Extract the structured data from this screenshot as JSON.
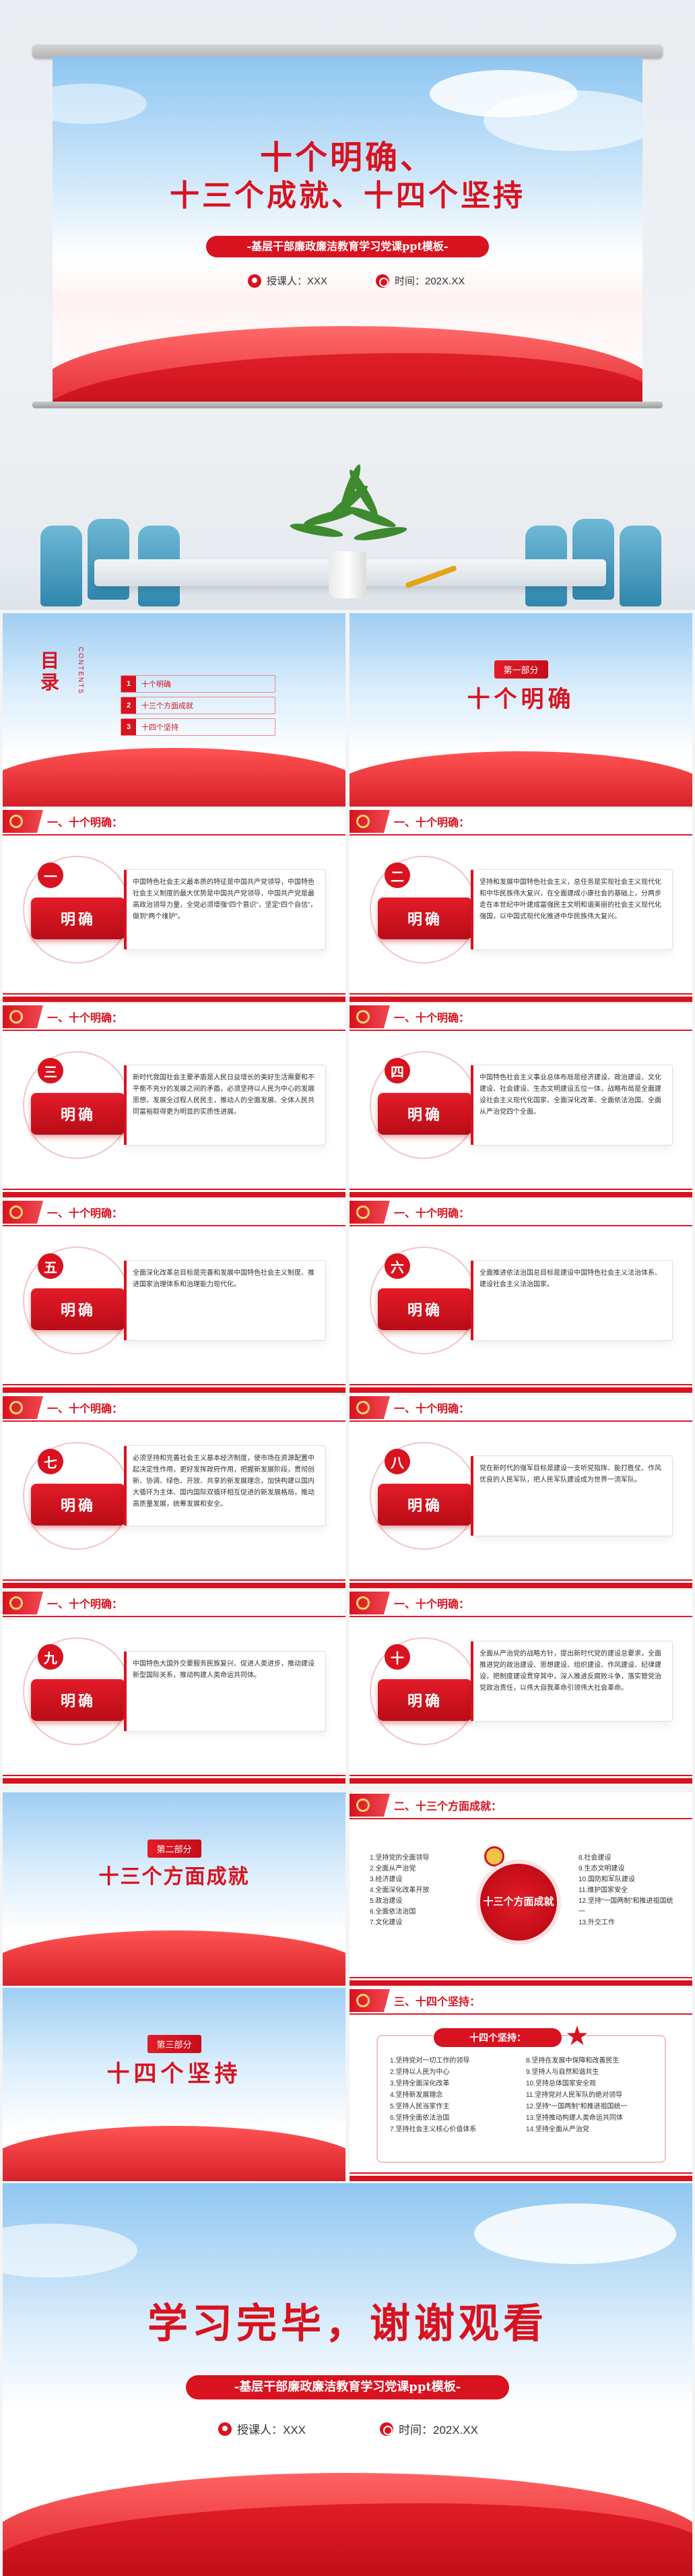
{
  "hero": {
    "title_line1": "十个明确、",
    "title_line2": "十三个成就、十四个坚持",
    "subtitle": "-基层干部廉政廉洁教育学习党课ppt模板-",
    "presenter_label": "授课人：XXX",
    "time_label": "时间：202X.XX"
  },
  "toc": {
    "title_line1": "目",
    "title_line2": "录",
    "en": "CONTENTS",
    "items": [
      {
        "num": "1",
        "label": "十个明确"
      },
      {
        "num": "2",
        "label": "十三个方面成就"
      },
      {
        "num": "3",
        "label": "十四个坚持"
      }
    ]
  },
  "part1": {
    "tag": "第一部分",
    "title": "十个明确"
  },
  "part2": {
    "tag": "第二部分",
    "title": "十三个方面成就"
  },
  "part3": {
    "tag": "第三部分",
    "title": "十四个坚持"
  },
  "section_titles": {
    "ten": "一、十个明确：",
    "thirteen": "二、十三个方面成就：",
    "fourteen": "三、十四个坚持："
  },
  "mingque_label": "明确",
  "ten_items": [
    {
      "num": "一",
      "text": "中国特色社会主义最本质的特征是中国共产党领导，中国特色社会主义制度的最大优势是中国共产党领导，中国共产党是最高政治领导力量，全党必须增强“四个意识”，坚定“四个自信”，做到“两个维护”。"
    },
    {
      "num": "二",
      "text": "坚持和发展中国特色社会主义，总任务是实现社会主义现代化和中华民族伟大复兴，在全面建成小康社会的基础上，分两步走在本世纪中叶建成富强民主文明和谐美丽的社会主义现代化强国，以中国式现代化推进中华民族伟大复兴。"
    },
    {
      "num": "三",
      "text": "新时代我国社会主要矛盾是人民日益增长的美好生活需要和不平衡不充分的发展之间的矛盾，必须坚持以人民为中心的发展思想，发展全过程人民民主，推动人的全面发展、全体人民共同富裕取得更为明显的实质性进展。"
    },
    {
      "num": "四",
      "text": "中国特色社会主义事业总体布局是经济建设、政治建设、文化建设、社会建设、生态文明建设五位一体，战略布局是全面建设社会主义现代化国家、全面深化改革、全面依法治国、全面从严治党四个全面。"
    },
    {
      "num": "五",
      "text": "全面深化改革总目标是完善和发展中国特色社会主义制度、推进国家治理体系和治理能力现代化。"
    },
    {
      "num": "六",
      "text": "全面推进依法治国总目标是建设中国特色社会主义法治体系、建设社会主义法治国家。"
    },
    {
      "num": "七",
      "text": "必须坚持和完善社会主义基本经济制度，使市场在资源配置中起决定性作用，更好发挥政府作用，把握新发展阶段，贯彻创新、协调、绿色、开放、共享的新发展理念，加快构建以国内大循环为主体、国内国际双循环相互促进的新发展格局，推动高质量发展，统筹发展和安全。"
    },
    {
      "num": "八",
      "text": "党在新时代的强军目标是建设一支听党指挥、能打胜仗、作风优良的人民军队，把人民军队建设成为世界一流军队。"
    },
    {
      "num": "九",
      "text": "中国特色大国外交要服务民族复兴、促进人类进步，推动建设新型国际关系，推动构建人类命运共同体。"
    },
    {
      "num": "十",
      "text": "全面从严治党的战略方针，提出新时代党的建设总要求，全面推进党的政治建设、思想建设、组织建设、作风建设、纪律建设，把制度建设贯穿其中，深入推进反腐败斗争，落实管党治党政治责任，以伟大自我革命引领伟大社会革命。"
    }
  ],
  "thirteen": {
    "center": "十三个方面成就",
    "left": [
      "1.坚持党的全面领导",
      "2.全面从严治党",
      "3.经济建设",
      "4.全面深化改革开放",
      "5.政治建设",
      "6.全面依法治国",
      "7.文化建设"
    ],
    "right": [
      "8.社会建设",
      "9.生态文明建设",
      "10.国防和军队建设",
      "11.维护国家安全",
      "12.坚持“一国两制”和推进祖国统一",
      "13.外交工作"
    ]
  },
  "fourteen": {
    "head": "十四个坚持：",
    "left": [
      "1.坚持党对一切工作的领导",
      "2.坚持以人民为中心",
      "3.坚持全面深化改革",
      "4.坚持新发展理念",
      "5.坚持人民当家作主",
      "6.坚持全面依法治国",
      "7.坚持社会主义核心价值体系"
    ],
    "right": [
      "8.坚持在发展中保障和改善民生",
      "9.坚持人与自然和谐共生",
      "10.坚持总体国家安全观",
      "11.坚持党对人民军队的绝对领导",
      "12.坚持“一国两制”和推进祖国统一",
      "13.坚持推动构建人类命运共同体",
      "14.坚持全面从严治党"
    ]
  },
  "final": {
    "title": "学习完毕，谢谢观看",
    "subtitle": "-基层干部廉政廉洁教育学习党课ppt模板-",
    "presenter_label": "授课人：XXX",
    "time_label": "时间：202X.XX"
  },
  "colors": {
    "primary": "#d9121f",
    "sky": "#8ec6f1"
  }
}
